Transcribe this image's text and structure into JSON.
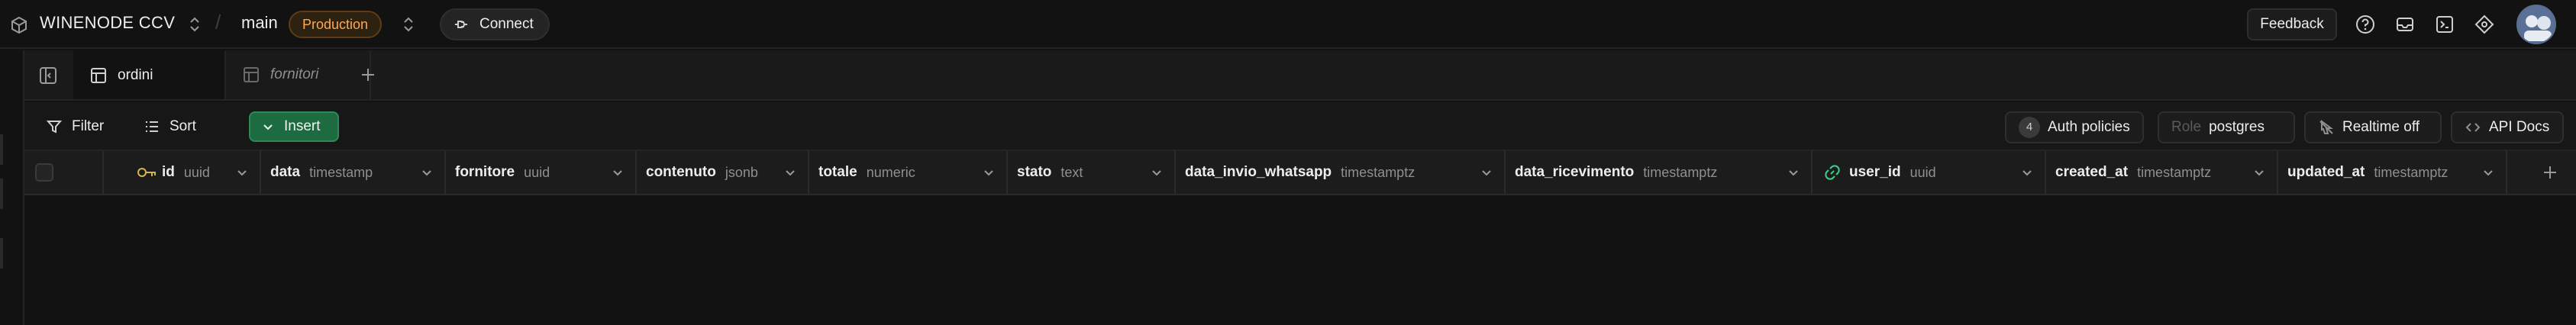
{
  "header": {
    "project_name": "WINENODE CCV",
    "separator": "/",
    "branch": "main",
    "environment_badge": "Production",
    "connect_label": "Connect",
    "feedback_label": "Feedback",
    "icons": [
      "help-icon",
      "inbox-icon",
      "terminal-icon",
      "assistant-icon"
    ]
  },
  "tabs": [
    {
      "label": "ordini",
      "active": true
    },
    {
      "label": "fornitori",
      "active": false
    }
  ],
  "toolbar": {
    "filter_label": "Filter",
    "sort_label": "Sort",
    "insert_label": "Insert",
    "auth_count": "4",
    "auth_label": "Auth policies",
    "role_prefix": "Role",
    "role_value": "postgres",
    "realtime_label": "Realtime off",
    "api_docs_label": "API Docs"
  },
  "columns": [
    {
      "name": "id",
      "type": "uuid",
      "key": "primary"
    },
    {
      "name": "data",
      "type": "timestamp"
    },
    {
      "name": "fornitore",
      "type": "uuid"
    },
    {
      "name": "contenuto",
      "type": "jsonb"
    },
    {
      "name": "totale",
      "type": "numeric"
    },
    {
      "name": "stato",
      "type": "text"
    },
    {
      "name": "data_invio_whatsapp",
      "type": "timestamptz"
    },
    {
      "name": "data_ricevimento",
      "type": "timestamptz"
    },
    {
      "name": "user_id",
      "type": "uuid",
      "key": "foreign"
    },
    {
      "name": "created_at",
      "type": "timestamptz"
    },
    {
      "name": "updated_at",
      "type": "timestamptz"
    }
  ],
  "colors": {
    "background": "#121212",
    "production_badge": "#ffa94d",
    "insert_button": "#1d6b41",
    "primary_key_icon": "#d4b54a"
  }
}
